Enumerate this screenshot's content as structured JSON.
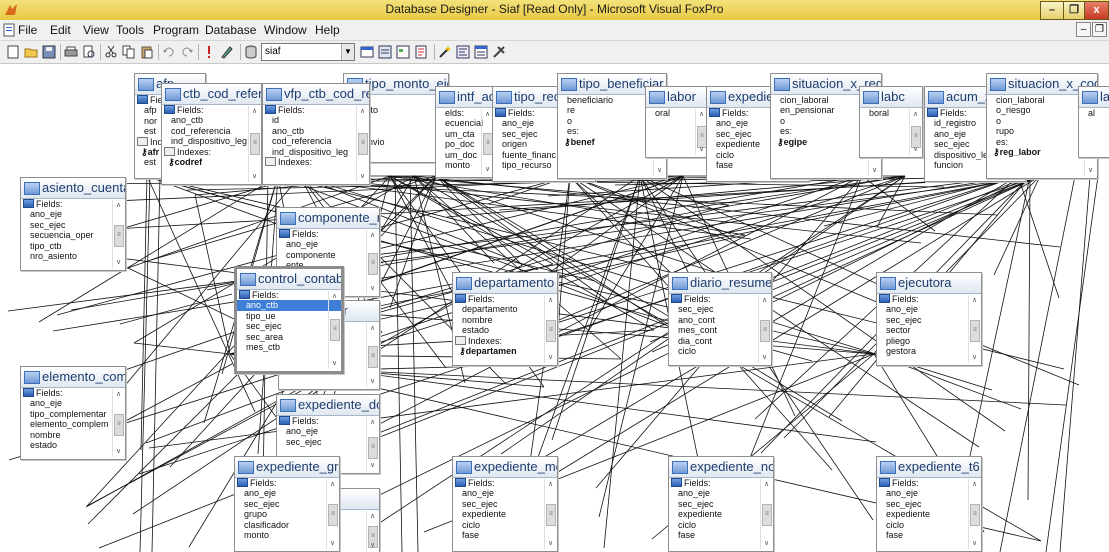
{
  "window": {
    "title": "Database Designer - Siaf [Read Only] - Microsoft Visual FoxPro",
    "min_label": "–",
    "max_label": "❐",
    "close_label": "x"
  },
  "menu": {
    "items": [
      "File",
      "Edit",
      "View",
      "Tools",
      "Program",
      "Database",
      "Window",
      "Help"
    ],
    "mdi_min": "–",
    "mdi_restore": "❐"
  },
  "toolbar": {
    "combo_value": "siaf",
    "combo_arrow": "▼"
  },
  "tables": [
    {
      "name": "afp",
      "rows": [
        {
          "t": "fh",
          "v": "Fiel"
        },
        {
          "t": "f",
          "v": "afp"
        },
        {
          "t": "f",
          "v": "nor"
        },
        {
          "t": "f",
          "v": "est"
        },
        {
          "t": "ih",
          "v": "Ind"
        },
        {
          "t": "k",
          "v": "afr"
        },
        {
          "t": "f",
          "v": "est"
        }
      ]
    },
    {
      "name": "ctb_cod_refere",
      "rows": [
        {
          "t": "fh",
          "v": "Fields:"
        },
        {
          "t": "f",
          "v": "ano_ctb"
        },
        {
          "t": "f",
          "v": "cod_referencia"
        },
        {
          "t": "f",
          "v": "ind_dispositivo_leg"
        },
        {
          "t": "ih",
          "v": "Indexes:"
        },
        {
          "t": "k",
          "v": "codref"
        }
      ]
    },
    {
      "name": "tipo_monto_eje",
      "rows": [
        {
          "t": "f",
          "v": "ejec"
        },
        {
          "t": "f",
          "v": "monto"
        },
        {
          "t": "f",
          "v": "re"
        },
        {
          "t": "f",
          "v": "o"
        },
        {
          "t": "f",
          "v": "o_envio"
        }
      ]
    },
    {
      "name": "vfp_ctb_cod_re",
      "rows": [
        {
          "t": "fh",
          "v": "Fields:"
        },
        {
          "t": "f",
          "v": "id"
        },
        {
          "t": "f",
          "v": "ano_ctb"
        },
        {
          "t": "f",
          "v": "cod_referencia"
        },
        {
          "t": "f",
          "v": "ind_dispositivo_leg"
        },
        {
          "t": "ih",
          "v": "Indexes:"
        }
      ]
    },
    {
      "name": "intf_adm",
      "rows": [
        {
          "t": "f",
          "v": "elds:"
        },
        {
          "t": "f",
          "v": "ecuencial"
        },
        {
          "t": "f",
          "v": "um_cta"
        },
        {
          "t": "f",
          "v": "po_doc"
        },
        {
          "t": "f",
          "v": "um_doc"
        },
        {
          "t": "f",
          "v": "monto"
        }
      ]
    },
    {
      "name": "tipo_recurso_ej",
      "rows": [
        {
          "t": "fh",
          "v": "Fields:"
        },
        {
          "t": "f",
          "v": "ano_eje"
        },
        {
          "t": "f",
          "v": "sec_ejec"
        },
        {
          "t": "f",
          "v": "origen"
        },
        {
          "t": "f",
          "v": "fuente_financ"
        },
        {
          "t": "f",
          "v": "tipo_recurso"
        }
      ]
    },
    {
      "name": "tipo_beneficiar",
      "rows": [
        {
          "t": "f",
          "v": "beneficiario"
        },
        {
          "t": "f",
          "v": "re"
        },
        {
          "t": "f",
          "v": "o"
        },
        {
          "t": "f",
          "v": "es:"
        },
        {
          "t": "k",
          "v": "benef"
        }
      ]
    },
    {
      "name": "labor",
      "rows": [
        {
          "t": "f",
          "v": "oral"
        }
      ]
    },
    {
      "name": "expediente_ad",
      "rows": [
        {
          "t": "fh",
          "v": "Fields:"
        },
        {
          "t": "f",
          "v": "ano_eje"
        },
        {
          "t": "f",
          "v": "sec_ejec"
        },
        {
          "t": "f",
          "v": "expediente"
        },
        {
          "t": "f",
          "v": "ciclo"
        },
        {
          "t": "f",
          "v": "fase"
        }
      ]
    },
    {
      "name": "situacion_x_reg",
      "rows": [
        {
          "t": "f",
          "v": "cion_laboral"
        },
        {
          "t": "f",
          "v": "en_pensionar"
        },
        {
          "t": "f",
          "v": "o"
        },
        {
          "t": "f",
          "v": "es:"
        },
        {
          "t": "k",
          "v": "egipe"
        }
      ]
    },
    {
      "name": "labc",
      "rows": [
        {
          "t": "f",
          "v": "boral"
        }
      ]
    },
    {
      "name": "acum_x_ubigec",
      "rows": [
        {
          "t": "fh",
          "v": "Fields:"
        },
        {
          "t": "f",
          "v": "id_registro"
        },
        {
          "t": "f",
          "v": "ano_eje"
        },
        {
          "t": "f",
          "v": "sec_ejec"
        },
        {
          "t": "f",
          "v": "dispositivo_legal"
        },
        {
          "t": "f",
          "v": "funcion"
        }
      ]
    },
    {
      "name": "situacion_x_coc",
      "rows": [
        {
          "t": "f",
          "v": "cion_laboral"
        },
        {
          "t": "f",
          "v": "o_riesgo"
        },
        {
          "t": "f",
          "v": "o"
        },
        {
          "t": "f",
          "v": "rupo"
        },
        {
          "t": "f",
          "v": "es:"
        },
        {
          "t": "k",
          "v": "reg_labor"
        }
      ]
    },
    {
      "name": "la",
      "rows": [
        {
          "t": "f",
          "v": "al"
        }
      ]
    },
    {
      "name": "asiento_cuenta",
      "rows": [
        {
          "t": "fh",
          "v": "Fields:"
        },
        {
          "t": "f",
          "v": "ano_eje"
        },
        {
          "t": "f",
          "v": "sec_ejec"
        },
        {
          "t": "f",
          "v": "secuencia_oper"
        },
        {
          "t": "f",
          "v": "tipo_ctb"
        },
        {
          "t": "f",
          "v": "nro_asiento"
        }
      ]
    },
    {
      "name": "componente_n",
      "rows": [
        {
          "t": "fh",
          "v": "Fields:"
        },
        {
          "t": "f",
          "v": "ano_eje"
        },
        {
          "t": "f",
          "v": "componente"
        },
        {
          "t": "f",
          "v": "ente"
        }
      ]
    },
    {
      "name": "pago_gr",
      "rows": [
        {
          "t": "f",
          "v": "grupo"
        },
        {
          "t": "f",
          "v": "secuencia"
        },
        {
          "t": "f",
          "v": "correlativo"
        }
      ]
    },
    {
      "name": "control_contab",
      "rows": [
        {
          "t": "fh",
          "v": "Fields:"
        },
        {
          "t": "f",
          "v": "ano_ctb",
          "hl": true
        },
        {
          "t": "f",
          "v": "tipo_ue"
        },
        {
          "t": "f",
          "v": "sec_ejec"
        },
        {
          "t": "f",
          "v": "sec_area"
        },
        {
          "t": "f",
          "v": "mes_ctb"
        }
      ]
    },
    {
      "name": "departamento",
      "rows": [
        {
          "t": "fh",
          "v": "Fields:"
        },
        {
          "t": "f",
          "v": "departamento"
        },
        {
          "t": "f",
          "v": "nombre"
        },
        {
          "t": "f",
          "v": "estado"
        },
        {
          "t": "ih",
          "v": "Indexes:"
        },
        {
          "t": "k",
          "v": "departamen"
        }
      ]
    },
    {
      "name": "diario_resumer",
      "rows": [
        {
          "t": "fh",
          "v": "Fields:"
        },
        {
          "t": "f",
          "v": "sec_ejec"
        },
        {
          "t": "f",
          "v": "ano_cont"
        },
        {
          "t": "f",
          "v": "mes_cont"
        },
        {
          "t": "f",
          "v": "dia_cont"
        },
        {
          "t": "f",
          "v": "ciclo"
        }
      ]
    },
    {
      "name": "ejecutora",
      "rows": [
        {
          "t": "fh",
          "v": "Fields:"
        },
        {
          "t": "f",
          "v": "ano_eje"
        },
        {
          "t": "f",
          "v": "sec_ejec"
        },
        {
          "t": "f",
          "v": "sector"
        },
        {
          "t": "f",
          "v": "pliego"
        },
        {
          "t": "f",
          "v": "gestora"
        }
      ]
    },
    {
      "name": "elemento_com",
      "rows": [
        {
          "t": "fh",
          "v": "Fields:"
        },
        {
          "t": "f",
          "v": "ano_eje"
        },
        {
          "t": "f",
          "v": "tipo_complementar"
        },
        {
          "t": "f",
          "v": "elemento_complem"
        },
        {
          "t": "f",
          "v": "nombre"
        },
        {
          "t": "f",
          "v": "estado"
        }
      ]
    },
    {
      "name": "expediente_do",
      "rows": [
        {
          "t": "fh",
          "v": "Fields:"
        },
        {
          "t": "f",
          "v": "ano_eje"
        },
        {
          "t": "f",
          "v": "sec_ejec"
        }
      ]
    },
    {
      "name": "nte_enl",
      "rows": []
    },
    {
      "name": "expediente_gr",
      "rows": [
        {
          "t": "fh",
          "v": "Fields:"
        },
        {
          "t": "f",
          "v": "ano_eje"
        },
        {
          "t": "f",
          "v": "sec_ejec"
        },
        {
          "t": "f",
          "v": "grupo"
        },
        {
          "t": "f",
          "v": "clasificador"
        },
        {
          "t": "f",
          "v": "monto"
        }
      ]
    },
    {
      "name": "expediente_me",
      "rows": [
        {
          "t": "fh",
          "v": "Fields:"
        },
        {
          "t": "f",
          "v": "ano_eje"
        },
        {
          "t": "f",
          "v": "sec_ejec"
        },
        {
          "t": "f",
          "v": "expediente"
        },
        {
          "t": "f",
          "v": "ciclo"
        },
        {
          "t": "f",
          "v": "fase"
        }
      ]
    },
    {
      "name": "expediente_no",
      "rows": [
        {
          "t": "fh",
          "v": "Fields:"
        },
        {
          "t": "f",
          "v": "ano_eje"
        },
        {
          "t": "f",
          "v": "sec_ejec"
        },
        {
          "t": "f",
          "v": "expediente"
        },
        {
          "t": "f",
          "v": "ciclo"
        },
        {
          "t": "f",
          "v": "fase"
        }
      ]
    },
    {
      "name": "expediente_t6",
      "rows": [
        {
          "t": "fh",
          "v": "Fields:"
        },
        {
          "t": "f",
          "v": "ano_eje"
        },
        {
          "t": "f",
          "v": "sec_ejec"
        },
        {
          "t": "f",
          "v": "expediente"
        },
        {
          "t": "f",
          "v": "ciclo"
        },
        {
          "t": "f",
          "v": "fase"
        }
      ]
    }
  ],
  "colors": {
    "titlebar": "#e8c945",
    "header_text": "#1d3d6e",
    "selection": "#3e7ed9",
    "relation_line": "#111111"
  }
}
